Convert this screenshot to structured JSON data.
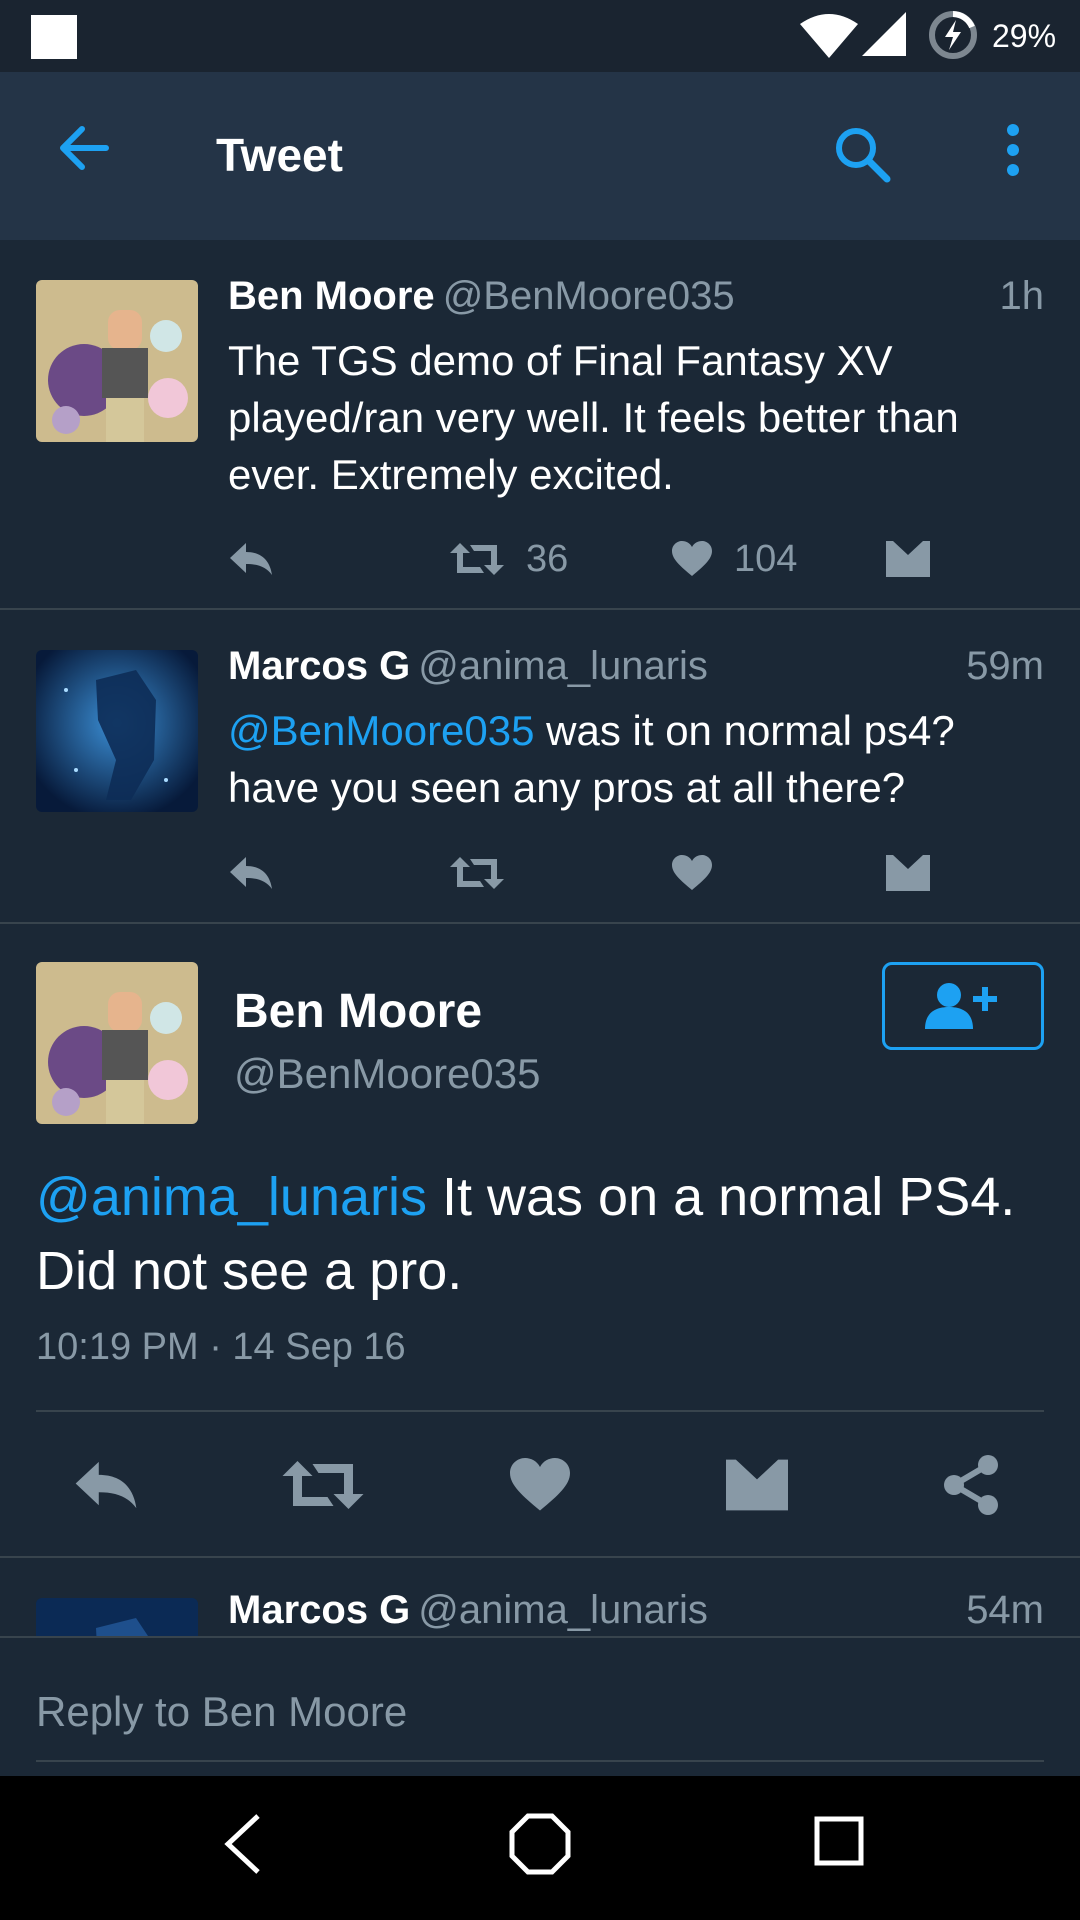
{
  "status_bar": {
    "battery_percent": "29%",
    "icons": [
      "notification-square-icon",
      "wifi-icon",
      "cell-signal-icon",
      "battery-charging-icon"
    ]
  },
  "app_bar": {
    "title": "Tweet",
    "icons": [
      "back-arrow-icon",
      "search-icon",
      "more-vertical-icon"
    ]
  },
  "tweets": [
    {
      "name": "Ben Moore",
      "handle": "@BenMoore035",
      "time": "1h",
      "text": "The TGS demo of Final Fantasy XV played/ran very well. It feels better than ever. Extremely excited.",
      "retweets": "36",
      "likes": "104"
    },
    {
      "name": "Marcos G",
      "handle": "@anima_lunaris",
      "time": "59m",
      "mention": "@BenMoore035",
      "text": " was it on normal ps4? have you seen any pros at all there?",
      "retweets": "",
      "likes": ""
    }
  ],
  "main_tweet": {
    "name": "Ben Moore",
    "handle": "@BenMoore035",
    "mention": "@anima_lunaris",
    "text": " It was on a normal PS4. Did not see a pro.",
    "timestamp": "10:19 PM · 14 Sep 16"
  },
  "next_reply": {
    "name": "Marcos G",
    "handle": "@anima_lunaris",
    "time": "54m"
  },
  "reply_bar": {
    "placeholder": "Reply to Ben Moore"
  },
  "colors": {
    "background": "#1b2836",
    "app_bar": "#243447",
    "accent": "#1da1f2",
    "secondary_text": "#8899a6",
    "icon_gray": "#8899a6"
  }
}
